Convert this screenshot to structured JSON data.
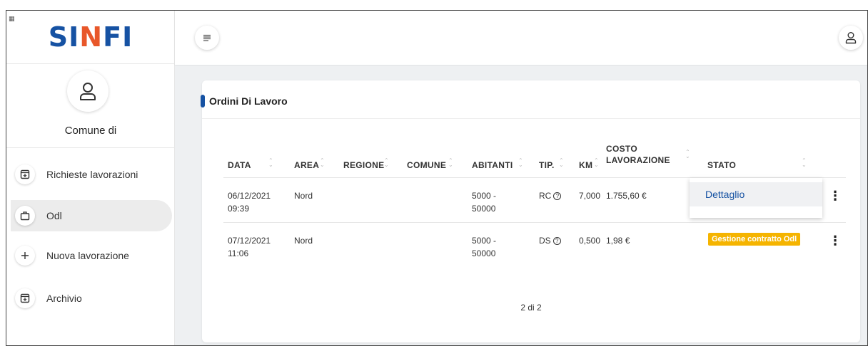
{
  "app": {
    "logo_left": "SI",
    "logo_mid": "N",
    "logo_right": "FI"
  },
  "user": {
    "name": "Comune di"
  },
  "sidebar": {
    "items": [
      {
        "label": "Richieste lavorazioni",
        "icon": "inbox-download-icon"
      },
      {
        "label": "Odl",
        "icon": "briefcase-icon",
        "active": true
      },
      {
        "label": "Nuova lavorazione",
        "icon": "plus-icon"
      },
      {
        "label": "Archivio",
        "icon": "archive-icon"
      }
    ]
  },
  "card": {
    "title": "Ordini Di Lavoro"
  },
  "table": {
    "headers": {
      "data": "DATA",
      "area": "AREA",
      "regione": "REGIONE",
      "comune": "COMUNE",
      "abitanti": "ABITANTI",
      "tip": "TIP.",
      "km": "KM",
      "costo_line1": "COSTO",
      "costo_line2": "LAVORAZIONE",
      "stato": "STATO"
    },
    "rows": [
      {
        "date": "06/12/2021",
        "time": "09:39",
        "area": "Nord",
        "regione": "",
        "comune": "",
        "abitanti_1": "5000 -",
        "abitanti_2": "50000",
        "tip": "RC",
        "km": "7,000",
        "costo": "1.755,60 €",
        "stato": ""
      },
      {
        "date": "07/12/2021",
        "time": "11:06",
        "area": "Nord",
        "regione": "",
        "comune": "",
        "abitanti_1": "5000 -",
        "abitanti_2": "50000",
        "tip": "DS",
        "km": "0,500",
        "costo": "1,98 €",
        "stato": "Gestione contratto Odl"
      }
    ]
  },
  "context_menu": {
    "item": "Dettaglio"
  },
  "pagination": {
    "label": "2 di 2"
  },
  "colors": {
    "brand_blue": "#1652a3",
    "brand_orange": "#e8572a",
    "badge": "#f5b400"
  }
}
